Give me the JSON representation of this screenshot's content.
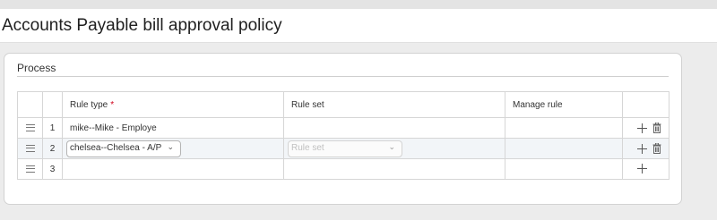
{
  "page": {
    "title": "Accounts Payable bill approval policy"
  },
  "section": {
    "title": "Process"
  },
  "table": {
    "columns": {
      "rule_type": "Rule type",
      "required_mark": "*",
      "rule_set": "Rule set",
      "manage_rule": "Manage rule"
    },
    "rows": [
      {
        "num": "1",
        "rule_type": "mike--Mike - Employe",
        "rule_set": "",
        "manage_rule": "",
        "selected": false
      },
      {
        "num": "2",
        "rule_type": "chelsea--Chelsea - A/P",
        "rule_set_placeholder": "Rule set",
        "manage_rule": "",
        "selected": true
      },
      {
        "num": "3",
        "rule_type": "",
        "rule_set": "",
        "manage_rule": "",
        "selected": false
      }
    ]
  },
  "icons": {
    "drag_handle": "drag-handle-icon",
    "add": "plus-icon",
    "delete": "trash-icon",
    "dropdown": "chevron-down-icon"
  },
  "colors": {
    "required": "#d0021b",
    "selected_row": "#f2f5f8"
  }
}
